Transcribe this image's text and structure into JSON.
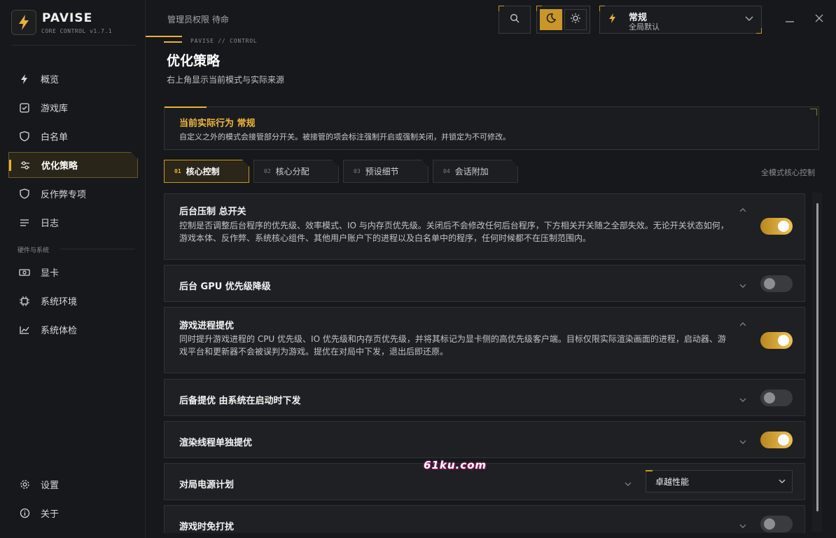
{
  "app": {
    "name": "PAVISE",
    "subtitle": "CORE CONTROL v1.7.1"
  },
  "sidebar": {
    "items": [
      {
        "label": "概览",
        "icon": "bolt-icon"
      },
      {
        "label": "游戏库",
        "icon": "check-square-icon"
      },
      {
        "label": "白名单",
        "icon": "shield-icon"
      },
      {
        "label": "优化策略",
        "icon": "sliders-icon",
        "active": true
      },
      {
        "label": "反作弊专项",
        "icon": "shield-icon"
      },
      {
        "label": "日志",
        "icon": "list-icon"
      }
    ],
    "section_label": "硬件与系统",
    "hardware_items": [
      {
        "label": "显卡",
        "icon": "gpu-icon"
      },
      {
        "label": "系统环境",
        "icon": "chip-icon"
      },
      {
        "label": "系统体检",
        "icon": "chart-icon"
      }
    ],
    "bottom_items": [
      {
        "label": "设置",
        "icon": "gear-icon"
      },
      {
        "label": "关于",
        "icon": "info-icon"
      }
    ]
  },
  "topbar": {
    "status": "管理员权限 待命",
    "mode_title": "常规",
    "mode_sub": "全局默认"
  },
  "breadcrumb": "PAVISE  //  CONTROL",
  "page": {
    "title": "优化策略",
    "subtitle": "右上角显示当前模式与实际来源"
  },
  "notice": {
    "title": "当前实际行为 常规",
    "body": "自定义之外的模式会接管部分开关。被接管的项会标注强制开启或强制关闭，并锁定为不可修改。"
  },
  "tabs": [
    {
      "num": "01",
      "label": "核心控制",
      "active": true
    },
    {
      "num": "02",
      "label": "核心分配"
    },
    {
      "num": "03",
      "label": "预设细节"
    },
    {
      "num": "04",
      "label": "会话附加"
    }
  ],
  "tab_right": "全模式核心控制",
  "cards": [
    {
      "title": "后台压制 总开关",
      "desc": "控制是否调整后台程序的优先级、效率模式、IO 与内存页优先级。关闭后不会修改任何后台程序，下方相关开关随之全部失效。无论开关状态如何，游戏本体、反作弊、系统核心组件、其他用户账户下的进程以及白名单中的程序，任何时候都不在压制范围内。",
      "on": true,
      "expanded": true
    },
    {
      "title": "后台 GPU 优先级降级",
      "on": false,
      "expanded": false
    },
    {
      "title": "游戏进程提优",
      "desc": "同时提升游戏进程的 CPU 优先级、IO 优先级和内存页优先级，并将其标记为显卡侧的高优先级客户端。目标仅限实际渲染画面的进程，启动器、游戏平台和更新器不会被误判为游戏。提优在对局中下发，退出后即还原。",
      "on": true,
      "expanded": true
    },
    {
      "title": "后备提优 由系统在启动时下发",
      "on": false,
      "expanded": false
    },
    {
      "title": "渲染线程单独提优",
      "on": true,
      "expanded": false
    },
    {
      "title": "对局电源计划",
      "select_value": "卓越性能",
      "expanded": false
    },
    {
      "title": "游戏时免打扰",
      "on": false,
      "expanded": false
    }
  ],
  "watermark": "61ku.com",
  "colors": {
    "accent": "#e8b13a",
    "background": "#17181b",
    "card": "#1f2023"
  }
}
